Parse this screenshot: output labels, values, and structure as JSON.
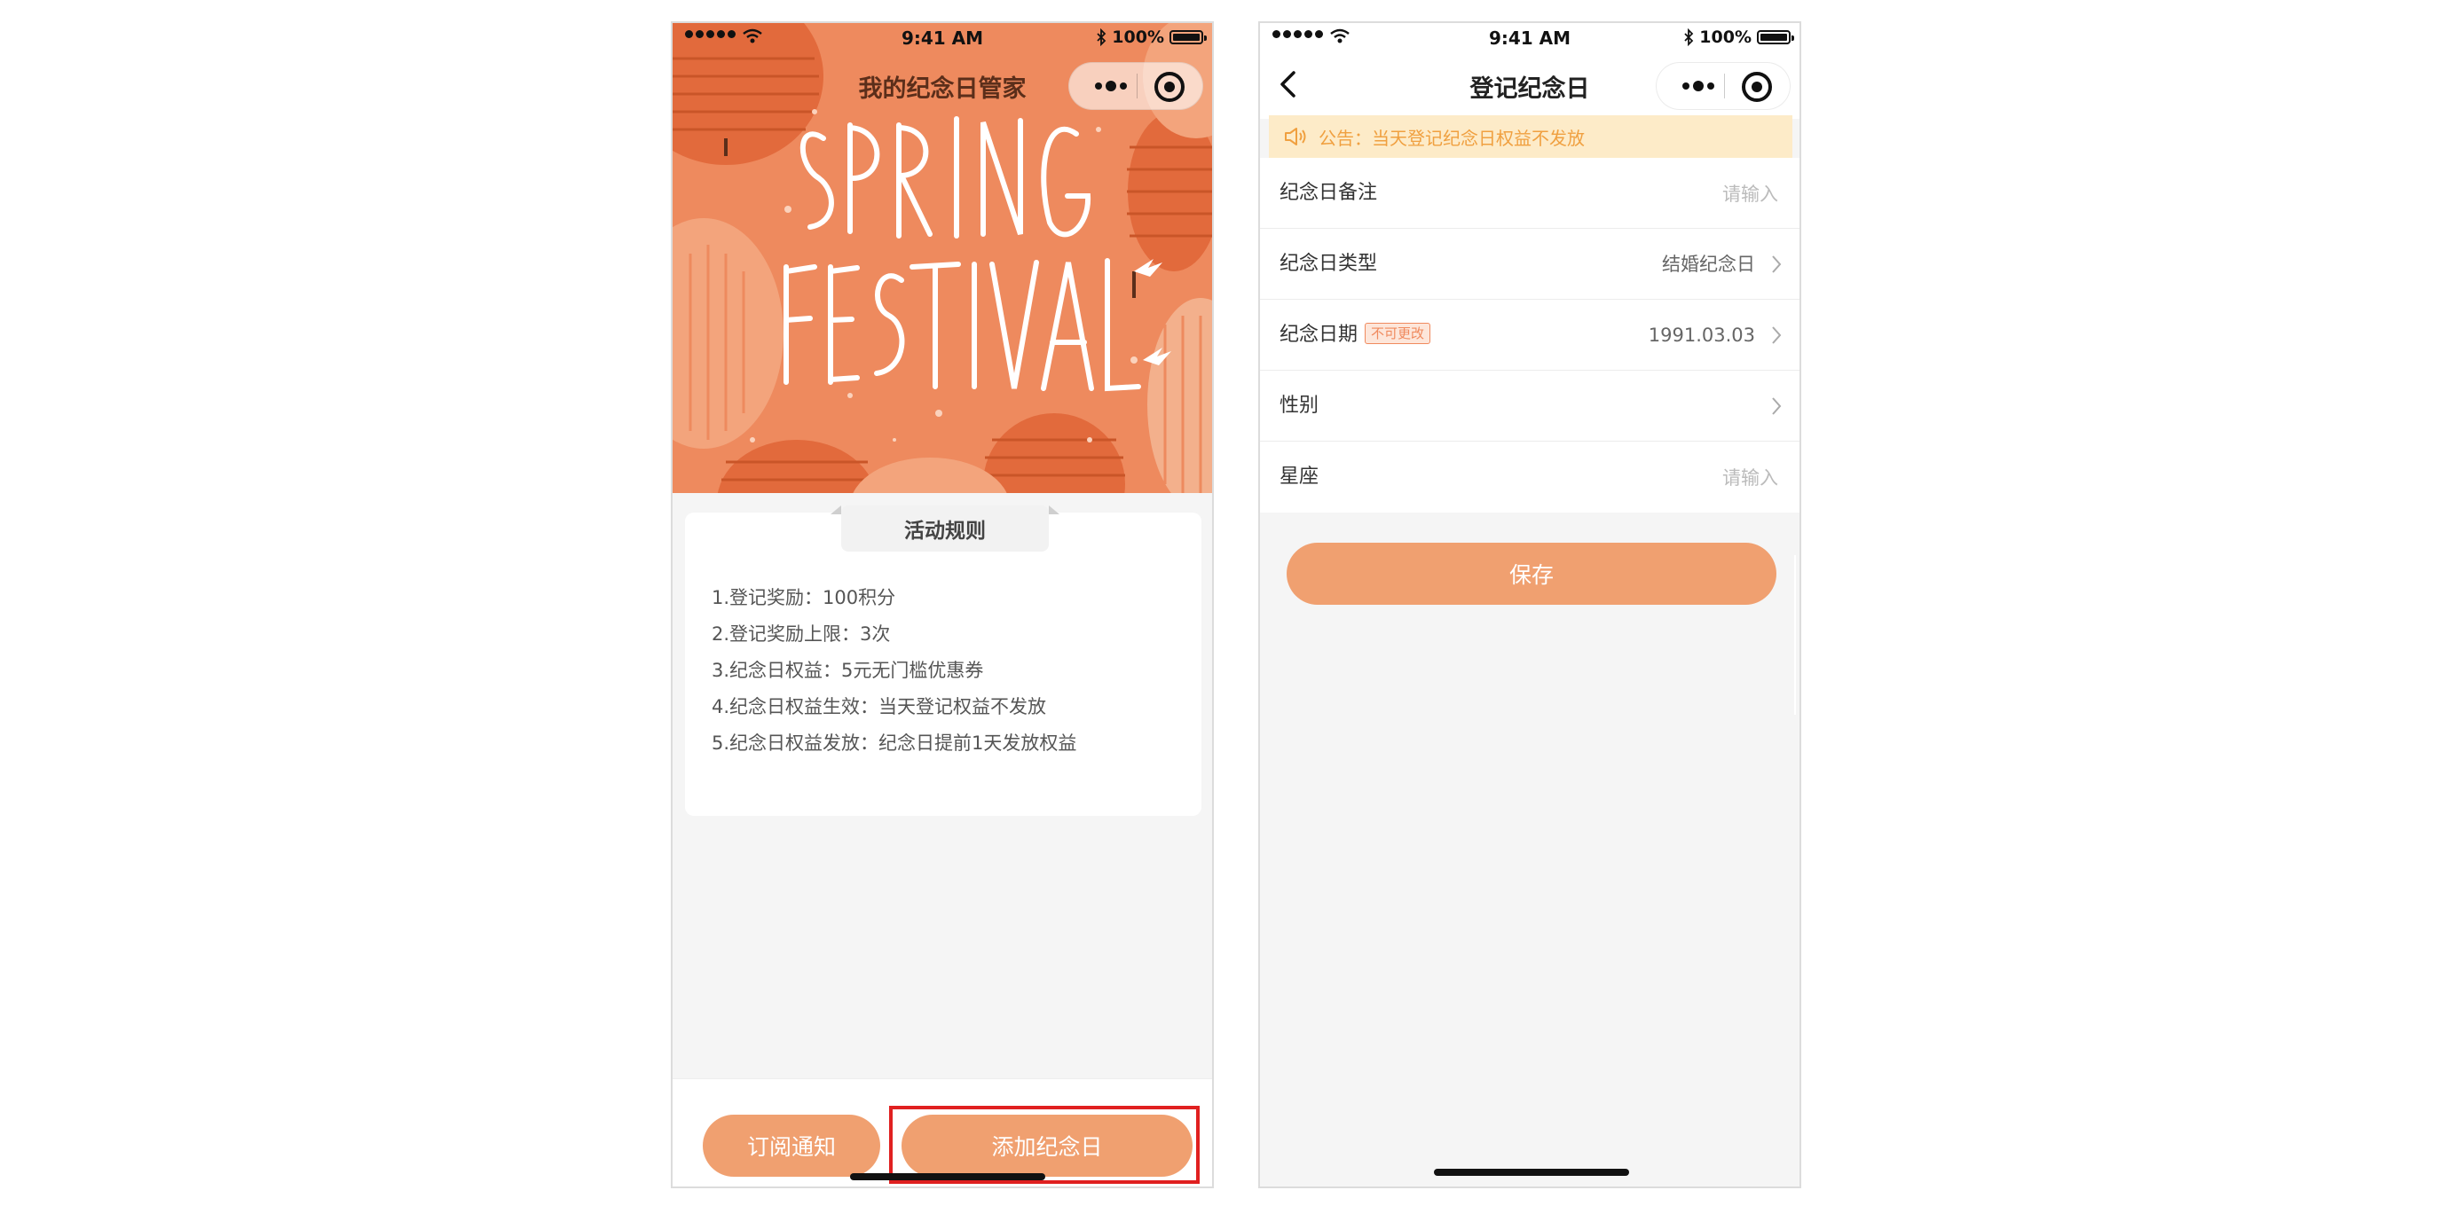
{
  "left_phone": {
    "status": {
      "time": "9:41 AM",
      "battery": "100%"
    },
    "header_title": "我的纪念日管家",
    "banner_text": {
      "line1": "SPRING",
      "line2": "FESTIVAL"
    },
    "rules": {
      "title": "活动规则",
      "items": [
        "1.登记奖励：100积分",
        "2.登记奖励上限：3次",
        "3.纪念日权益：5元无门槛优惠券",
        "4.纪念日权益生效：当天登记权益不发放",
        "5.纪念日权益发放：纪念日提前1天发放权益"
      ]
    },
    "buttons": {
      "subscribe": "订阅通知",
      "add": "添加纪念日"
    }
  },
  "right_phone": {
    "status": {
      "time": "9:41 AM",
      "battery": "100%"
    },
    "nav_title": "登记纪念日",
    "notice": "公告：当天登记纪念日权益不发放",
    "form": {
      "note": {
        "label": "纪念日备注",
        "placeholder": "请输入"
      },
      "type": {
        "label": "纪念日类型",
        "value": "结婚纪念日"
      },
      "date": {
        "label": "纪念日期",
        "tag": "不可更改",
        "value": "1991.03.03"
      },
      "gender": {
        "label": "性别",
        "value": ""
      },
      "zodiac": {
        "label": "星座",
        "placeholder": "请输入"
      }
    },
    "save_label": "保存"
  },
  "colors": {
    "accent": "#f0a070",
    "banner_bg": "#ee8a5e",
    "notice_bg": "#fdebc8",
    "notice_text": "#f0a040",
    "highlight": "#e02020"
  }
}
